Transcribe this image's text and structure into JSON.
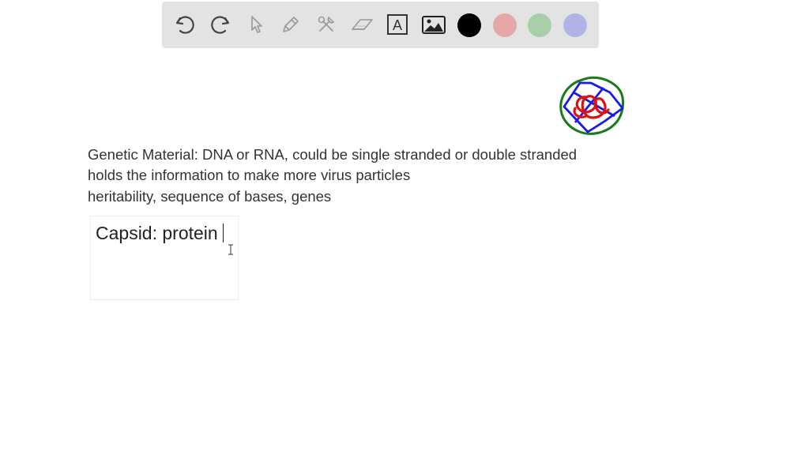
{
  "toolbar": {
    "tools": [
      {
        "name": "undo-icon",
        "label": "Undo"
      },
      {
        "name": "redo-icon",
        "label": "Redo"
      },
      {
        "name": "pointer-icon",
        "label": "Select"
      },
      {
        "name": "pen-icon",
        "label": "Pen"
      },
      {
        "name": "tools-icon",
        "label": "Tools"
      },
      {
        "name": "eraser-icon",
        "label": "Eraser"
      },
      {
        "name": "text-tool-icon",
        "label": "Text"
      },
      {
        "name": "image-icon",
        "label": "Image"
      }
    ],
    "text_tool_glyph": "A",
    "colors": {
      "black": "#000000",
      "red": "#e8a7a7",
      "green": "#a9cfa9",
      "blue": "#b1b3e6"
    }
  },
  "notes": {
    "line1": "Genetic Material: DNA or RNA, could be single stranded or double stranded",
    "line2": "holds the information to make more virus particles",
    "line3": "heritability, sequence of bases, genes"
  },
  "textbox": {
    "value": "Capsid: protein"
  },
  "drawing": {
    "stroke_colors": [
      "#1a7a1a",
      "#1a1ae0",
      "#e01010"
    ]
  }
}
